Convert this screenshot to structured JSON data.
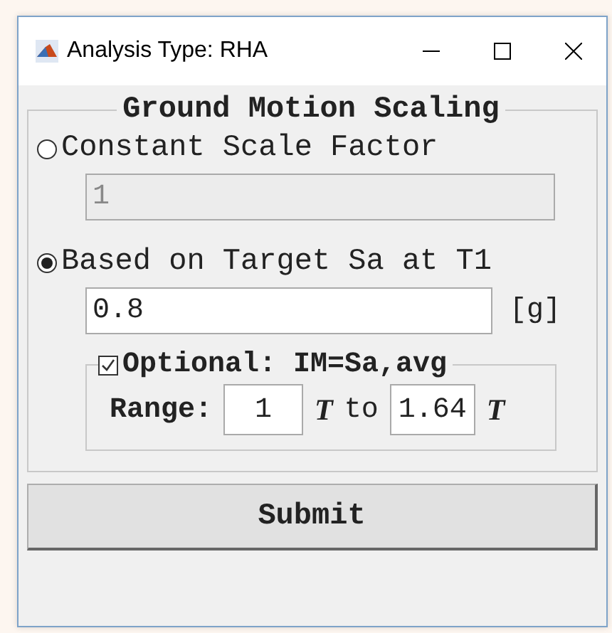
{
  "window": {
    "title": "Analysis Type: RHA"
  },
  "group": {
    "title": "Ground Motion Scaling",
    "options": [
      {
        "label": "Constant Scale Factor",
        "selected": false,
        "value": "1",
        "disabled": true
      },
      {
        "label": "Based on Target Sa at T1",
        "selected": true,
        "value": "0.8",
        "disabled": false,
        "unit": "[g]"
      }
    ],
    "optional": {
      "label": "Optional: IM=Sa,avg",
      "checked": true,
      "range_label": "Range:",
      "from": "1",
      "from_unit": "T",
      "to_label": "to",
      "to": "1.64",
      "to_unit": "T"
    }
  },
  "buttons": [
    "Submit"
  ]
}
